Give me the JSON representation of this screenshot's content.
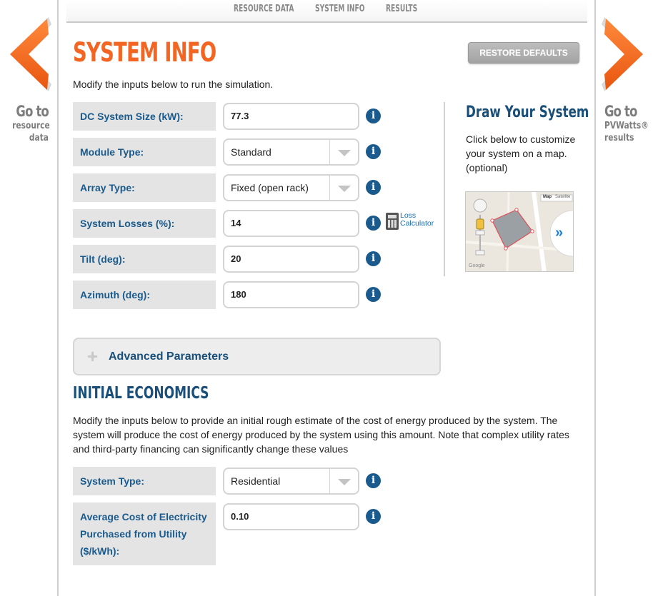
{
  "topnav": {
    "tabs": [
      {
        "label": "RESOURCE DATA"
      },
      {
        "label": "SYSTEM INFO"
      },
      {
        "label": "RESULTS"
      }
    ]
  },
  "nav_left": {
    "big": "Go to",
    "line1": "resource",
    "line2": "data"
  },
  "nav_right": {
    "big": "Go to",
    "line1": "PVWatts®",
    "line2": "results"
  },
  "header": {
    "title": "SYSTEM INFO",
    "restore_label": "RESTORE DEFAULTS",
    "intro": "Modify the inputs below to run the simulation."
  },
  "system_inputs": [
    {
      "label": "DC System Size (kW):",
      "value": "77.3",
      "kind": "input"
    },
    {
      "label": "Module Type:",
      "value": "Standard",
      "kind": "select"
    },
    {
      "label": "Array Type:",
      "value": "Fixed (open rack)",
      "kind": "select"
    },
    {
      "label": "System Losses (%):",
      "value": "14",
      "kind": "input"
    },
    {
      "label": "Tilt (deg):",
      "value": "20",
      "kind": "input"
    },
    {
      "label": "Azimuth (deg):",
      "value": "180",
      "kind": "input"
    }
  ],
  "loss_calculator": {
    "line1": "Loss",
    "line2": "Calculator"
  },
  "draw_system": {
    "title": "Draw Your System",
    "description": "Click below to customize your system on a map. (optional)",
    "map_buttons": [
      "Map",
      "Satellite"
    ],
    "map_watermark": "Google"
  },
  "advanced": {
    "label": "Advanced Parameters"
  },
  "economics": {
    "title": "INITIAL ECONOMICS",
    "description": "Modify the inputs below to provide an initial rough estimate of the cost of energy produced by the system. The system will produce the cost of energy produced by the system using this amount. Note that complex utility rates and third-party financing can significantly change these values",
    "inputs": [
      {
        "label": "System Type:",
        "value": "Residential",
        "kind": "select"
      },
      {
        "label": "Average Cost of Electricity Purchased from Utility ($/kWh):",
        "value": "0.10",
        "kind": "input"
      }
    ]
  },
  "info_glyph": "i",
  "colors": {
    "accent_orange": "#f26522",
    "label_blue": "#1a5a8c",
    "heading_blue": "#1a4f7a"
  }
}
